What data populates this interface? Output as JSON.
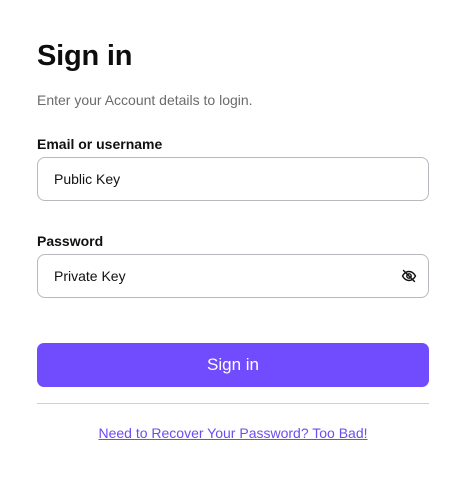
{
  "form": {
    "title": "Sign in",
    "subtitle": "Enter your Account details to login.",
    "email_label": "Email or username",
    "email_placeholder": "Public Key",
    "password_label": "Password",
    "password_placeholder": "Private Key",
    "password_toggle_icon": "eye-slash-icon",
    "submit_label": "Sign in",
    "recover_link": "Need to Recover Your Password? Too Bad!"
  },
  "colors": {
    "accent": "#714cfe",
    "link": "#6d4cf0",
    "border": "#b8b8bf",
    "subtitle": "#6b6b6b"
  }
}
